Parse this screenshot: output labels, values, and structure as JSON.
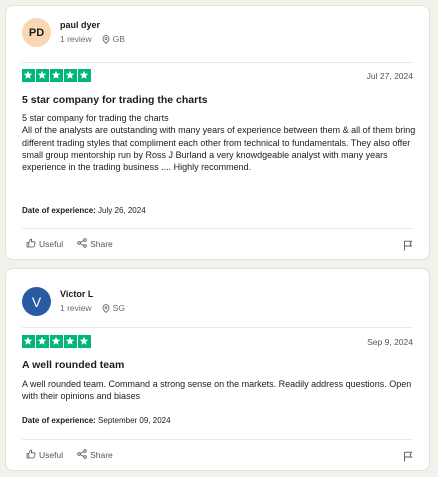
{
  "reviews": [
    {
      "avatar_initials": "PD",
      "reviewer_name": "paul dyer",
      "review_count": "1 review",
      "country": "GB",
      "rating": 5,
      "date": "Jul 27, 2024",
      "title": "5 star company for trading the charts",
      "body_lines": [
        "5 star company for trading the charts",
        "All of the analysts are outstanding with many years of experience between them & all of them bring different trading styles that compliment each other from technical to fundamentals. They also offer small group mentorship run by Ross J Burland a very knowdgeable analyst with many years experience in the trading business .... Highly recommend."
      ],
      "experience_label": "Date of experience:",
      "experience_date": "July 26, 2024",
      "useful_label": "Useful",
      "share_label": "Share"
    },
    {
      "avatar_initials": "V",
      "reviewer_name": "Victor L",
      "review_count": "1 review",
      "country": "SG",
      "rating": 5,
      "date": "Sep 9, 2024",
      "title": "A well rounded team",
      "body_lines": [
        "A well rounded team. Command a strong sense on the markets. Readily address questions. Open with their opinions and biases"
      ],
      "experience_label": "Date of experience:",
      "experience_date": "September 09, 2024",
      "useful_label": "Useful",
      "share_label": "Share"
    }
  ],
  "colors": {
    "star_green": "#00b67a",
    "avatar_pd": "#f9d6b4",
    "avatar_v": "#2a5aa1"
  },
  "icons": [
    "location-pin-icon",
    "thumbs-up-icon",
    "share-icon",
    "flag-icon",
    "star-icon"
  ]
}
